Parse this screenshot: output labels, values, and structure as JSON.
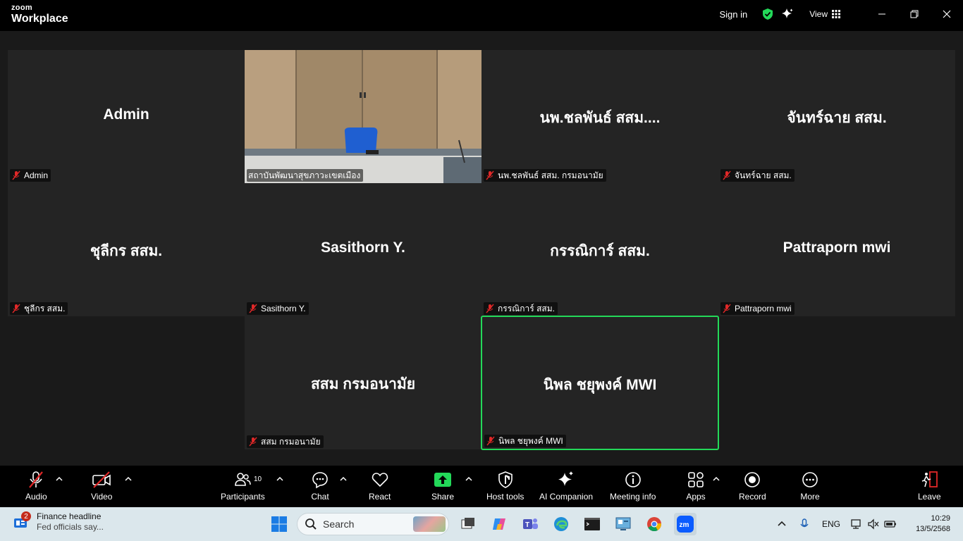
{
  "titlebar": {
    "logo_line1": "zoom",
    "logo_line2": "Workplace",
    "sign_in": "Sign in",
    "view_label": "View"
  },
  "participants": [
    {
      "display": "Admin",
      "label": "Admin",
      "video": false
    },
    {
      "display": "",
      "label": "สถาบันพัฒนาสุขภาวะเขตเมือง",
      "video": true
    },
    {
      "display": "นพ.ชลพันธ์ สสม....",
      "label": "นพ.ชลพันธ์ สสม. กรมอนามัย",
      "video": false
    },
    {
      "display": "จันทร์ฉาย สสม.",
      "label": "จันทร์ฉาย สสม.",
      "video": false
    },
    {
      "display": "ชุลีกร สสม.",
      "label": "ชุลีกร สสม.",
      "video": false
    },
    {
      "display": "Sasithorn Y.",
      "label": "Sasithorn Y.",
      "video": false
    },
    {
      "display": "กรรณิการ์ สสม.",
      "label": "กรรณิการ์ สสม.",
      "video": false
    },
    {
      "display": "Pattraporn mwi",
      "label": "Pattraporn mwi",
      "video": false
    },
    {
      "display": "สสม กรมอนามัย",
      "label": "สสม กรมอนามัย",
      "video": false
    },
    {
      "display": "นิพล ชยุพงค์  MWI",
      "label": "นิพล ชยุพงค์ MWI",
      "video": false,
      "active_speaker": true
    }
  ],
  "toolbar": {
    "audio": "Audio",
    "video": "Video",
    "participants": "Participants",
    "participant_count": "10",
    "chat": "Chat",
    "react": "React",
    "share": "Share",
    "host_tools": "Host tools",
    "ai_companion": "AI Companion",
    "meeting_info": "Meeting info",
    "apps": "Apps",
    "record": "Record",
    "more": "More",
    "leave": "Leave"
  },
  "colors": {
    "share_green": "#23d959",
    "leave_red": "#e02828",
    "muted_red": "#e02828",
    "active_border": "#23d959"
  },
  "taskbar": {
    "news_badge": "2",
    "news_title": "Finance headline",
    "news_sub": "Fed officials say...",
    "search_placeholder": "Search",
    "lang": "ENG",
    "time": "10:29",
    "date": "13/5/2568"
  }
}
